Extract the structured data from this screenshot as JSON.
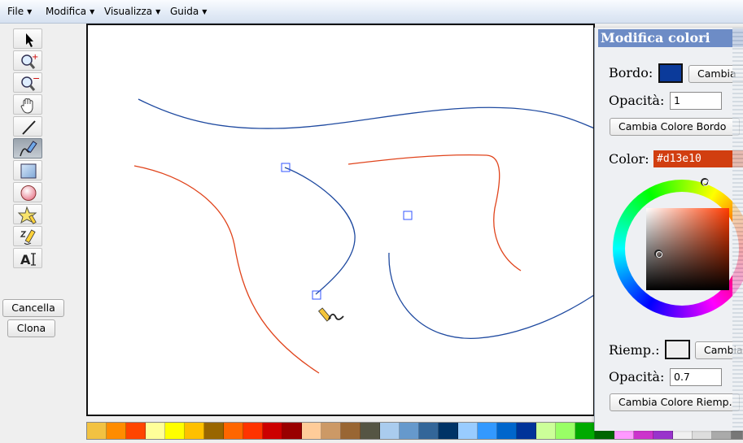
{
  "menu": [
    {
      "label": "File"
    },
    {
      "label": "Modifica"
    },
    {
      "label": "Visualizza"
    },
    {
      "label": "Guida"
    }
  ],
  "toolbar": {
    "tools": [
      {
        "icon": "select-arrow-icon"
      },
      {
        "icon": "zoom-in-icon"
      },
      {
        "icon": "zoom-out-icon"
      },
      {
        "icon": "pan-hand-icon"
      },
      {
        "icon": "line-icon"
      },
      {
        "icon": "path-pen-icon",
        "active": true
      },
      {
        "icon": "rectangle-icon"
      },
      {
        "icon": "ellipse-icon"
      },
      {
        "icon": "star-shape-icon"
      },
      {
        "icon": "freehand-pencil-icon"
      },
      {
        "icon": "text-tool-icon"
      }
    ],
    "cancel_label": "Cancella",
    "clone_label": "Clona"
  },
  "panel": {
    "title": "Modifica colori",
    "stroke_label": "Bordo:",
    "stroke_color": "#0b3a9a",
    "change_label": "Cambia",
    "opacity_label": "Opacità:",
    "stroke_opacity": "1",
    "change_stroke_label": "Cambia Colore Bordo",
    "color_label": "Color:",
    "color_hex": "#d13e10",
    "fill_label": "Riemp.:",
    "fill_color": "#eeeeee",
    "fill_change_label": "Cambia",
    "fill_opacity_label": "Opacità:",
    "fill_opacity": "0.7",
    "change_fill_label": "Cambia Colore Riemp."
  },
  "colors": {
    "blue_stroke": "#1f4aa0",
    "red_stroke": "#e0441c",
    "node_handle": "#3355ff"
  },
  "palette": [
    "#f2c242",
    "#ff8c00",
    "#ff4500",
    "#ffff99",
    "#ffff00",
    "#ffc000",
    "#996600",
    "#ff6600",
    "#ff3300",
    "#cc0000",
    "#990000",
    "#ffcc99",
    "#cc9966",
    "#996633",
    "#555544",
    "#aaccee",
    "#6699cc",
    "#336699",
    "#003366",
    "#99ccff",
    "#3399ff",
    "#0066cc",
    "#003399",
    "#ccff99",
    "#99ff66",
    "#00aa00",
    "#006600",
    "#ff99ff",
    "#cc33cc",
    "#9933cc",
    "#f0f0f0",
    "#dddddd",
    "#aaaaaa",
    "#777777"
  ]
}
